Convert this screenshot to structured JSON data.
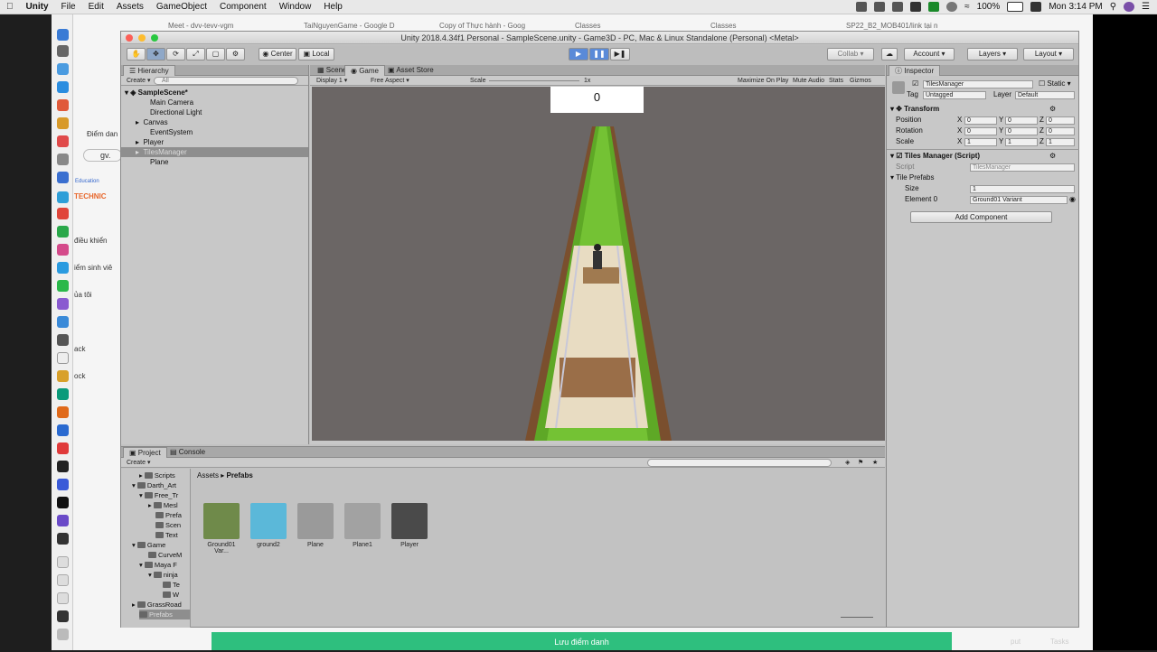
{
  "menubar": {
    "app": "Unity",
    "items": [
      "File",
      "Edit",
      "Assets",
      "GameObject",
      "Component",
      "Window",
      "Help"
    ],
    "battery": "100%",
    "clock": "Mon 3:14 PM"
  },
  "browser": {
    "tabs": [
      "Meet - dvv-tevv-vgm",
      "TaiNguyenGame - Google D",
      "Copy of Thực hành - Goog",
      "Classes",
      "Classes",
      "SP22_B2_MOB401/link tại n"
    ],
    "sidebar_texts": [
      "Điểm dan",
      "gv.",
      "Education",
      "TECHNIC",
      "điều khiển",
      "iểm sinh viê",
      "ủa tôi",
      "ack",
      "ock"
    ],
    "save_button": "Lưu điểm danh",
    "footer_right": [
      "put",
      "Tasks"
    ]
  },
  "unity": {
    "title": "Unity 2018.4.34f1 Personal - SampleScene.unity - Game3D - PC, Mac & Linux Standalone (Personal) <Metal>",
    "toolbar": {
      "center": "Center",
      "local": "Local",
      "collab": "Collab",
      "account": "Account",
      "layers": "Layers",
      "layout": "Layout"
    },
    "hierarchy": {
      "tab": "Hierarchy",
      "create": "Create",
      "search_placeholder": "All",
      "scene": "SampleScene*",
      "items": [
        "Main Camera",
        "Directional Light",
        "Canvas",
        "EventSystem",
        "Player",
        "TilesManager",
        "Plane"
      ],
      "selected_index": 5
    },
    "game": {
      "tabs": [
        "Scene",
        "Game",
        "Asset Store"
      ],
      "display": "Display 1",
      "aspect": "Free Aspect",
      "scale_label": "Scale",
      "scale_value": "1x",
      "options": [
        "Maximize On Play",
        "Mute Audio",
        "Stats",
        "Gizmos"
      ],
      "score": "0"
    },
    "inspector": {
      "tab": "Inspector",
      "object_name": "TilesManager",
      "static": "Static",
      "tag_label": "Tag",
      "tag": "Untagged",
      "layer_label": "Layer",
      "layer": "Default",
      "transform": {
        "title": "Transform",
        "rows": [
          {
            "label": "Position",
            "x": "0",
            "y": "0",
            "z": "0"
          },
          {
            "label": "Rotation",
            "x": "0",
            "y": "0",
            "z": "0"
          },
          {
            "label": "Scale",
            "x": "1",
            "y": "1",
            "z": "1"
          }
        ]
      },
      "script": {
        "title": "Tiles Manager (Script)",
        "script_label": "Script",
        "script_value": "TilesManager",
        "prefabs_label": "Tile Prefabs",
        "size_label": "Size",
        "size_value": "1",
        "element_label": "Element 0",
        "element_value": "Ground01 Variant"
      },
      "add_component": "Add Component"
    },
    "project": {
      "tabs": [
        "Project",
        "Console"
      ],
      "create": "Create",
      "breadcrumb": [
        "Assets",
        "Prefabs"
      ],
      "tree": [
        "Scripts",
        "Darth_Art",
        "Free_Tr",
        "Mesl",
        "Prefa",
        "Scen",
        "Text",
        "Game",
        "CurveM",
        "Maya F",
        "ninja",
        "Te",
        "W",
        "GrassRoad",
        "Prefabs"
      ],
      "assets": [
        {
          "name": "Ground01 Var...",
          "color": "#6f8a4a"
        },
        {
          "name": "ground2",
          "color": "#5bb8d9"
        },
        {
          "name": "Plane",
          "color": "#9a9a9a"
        },
        {
          "name": "Plane1",
          "color": "#a2a2a2"
        },
        {
          "name": "Player",
          "color": "#4a4a4a"
        }
      ]
    }
  }
}
